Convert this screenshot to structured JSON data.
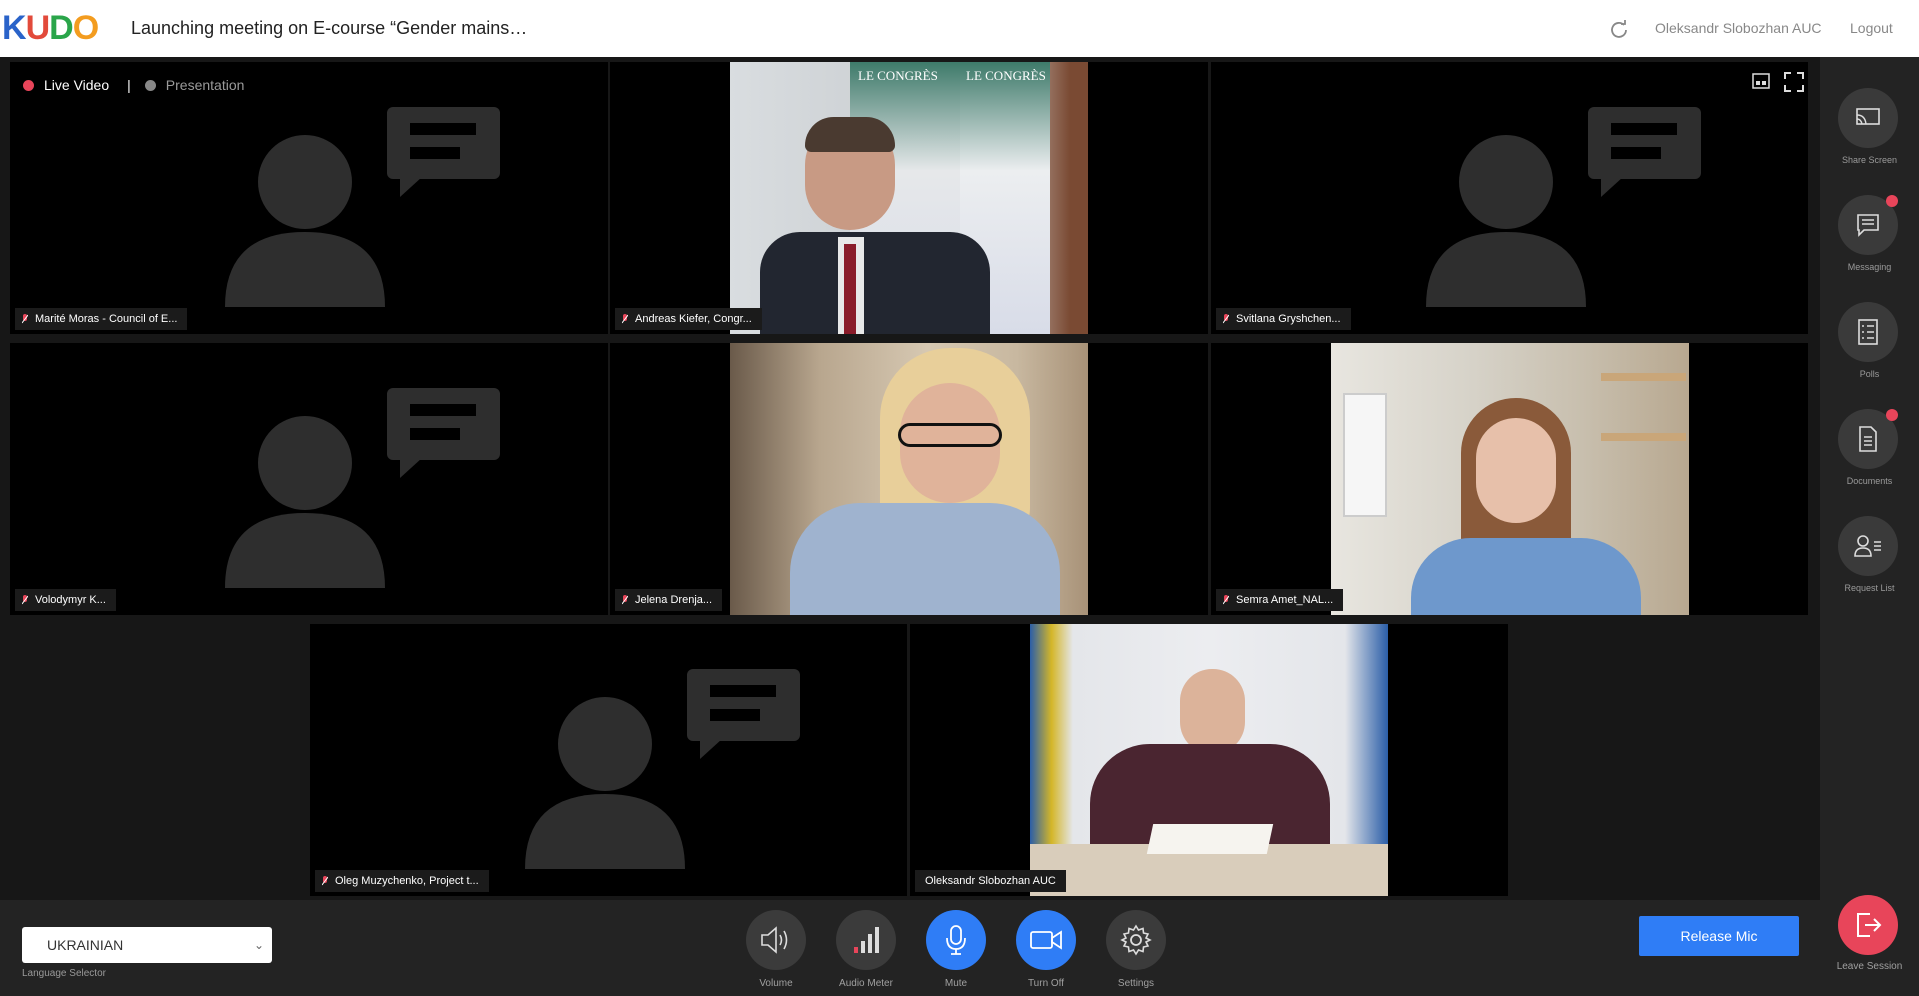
{
  "header": {
    "logo": [
      "K",
      "U",
      "D",
      "O"
    ],
    "meeting_title": "Launching meeting on E-course “Gender mains…",
    "username": "Oleksandr Slobozhan AUC",
    "logout": "Logout"
  },
  "stage": {
    "live_video": "Live Video",
    "separator": "|",
    "presentation": "Presentation",
    "participants": [
      {
        "name": "Marité Moras - Council of E...",
        "video": false
      },
      {
        "name": "Andreas Kiefer, Congr...",
        "video": true
      },
      {
        "name": "Svitlana Gryshchen...",
        "video": false
      },
      {
        "name": "Volodymyr K...",
        "video": false
      },
      {
        "name": "Jelena Drenja...",
        "video": true
      },
      {
        "name": "Semra Amet_NAL...",
        "video": true
      },
      {
        "name": "Oleg Muzychenko, Project t...",
        "video": false
      },
      {
        "name": "Oleksandr Slobozhan AUC",
        "video": true
      }
    ],
    "congress_banner_text": [
      "LE CONGRÈS",
      "LE CONGRÈS"
    ]
  },
  "rail": {
    "share_screen": "Share Screen",
    "messaging": "Messaging",
    "polls": "Polls",
    "documents": "Documents",
    "request_list": "Request List",
    "leave_session": "Leave Session"
  },
  "bottom": {
    "language_value": "UKRAINIAN",
    "language_label": "Language Selector",
    "volume": "Volume",
    "audio_meter": "Audio Meter",
    "mute": "Mute",
    "turn_off": "Turn Off",
    "settings": "Settings",
    "release_mic": "Release Mic"
  },
  "colors": {
    "accent": "#2f7df6",
    "danger": "#e8455a",
    "live_dot": "#e8455a",
    "presentation_dot": "#888888"
  }
}
